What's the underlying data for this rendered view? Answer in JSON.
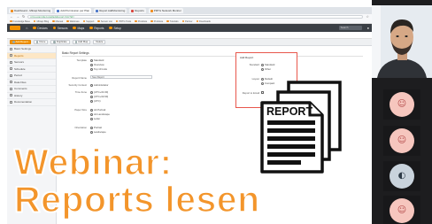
{
  "browser": {
    "tabs": [
      {
        "label": "Dashboard - Mitrapi Monitoring",
        "fav": "o",
        "active": false
      },
      {
        "label": "Add Permission per Plan",
        "fav": "b",
        "active": true
      },
      {
        "label": "Report AddMonitoring",
        "fav": "b",
        "active": false
      },
      {
        "label": "Reports",
        "fav": "r",
        "active": false
      },
      {
        "label": "PRTG Network Monitor",
        "fav": "o",
        "active": false
      }
    ],
    "url": "prtg.example.local/addreport.htm?id=",
    "bookmarks": [
      "Knowledge Base",
      "Mitrapi Blog",
      "Manual",
      "Webinare",
      "Support",
      "Sensor List",
      "PRTG Tools",
      "Preisliste",
      "Produkte",
      "Tutorials",
      "Partner",
      "Downloads"
    ]
  },
  "app": {
    "header_items": [
      "Devices",
      "Sensors",
      "Maps",
      "Reports",
      "Setup"
    ],
    "search_placeholder": "Search",
    "page_title": "ADD REPORT",
    "action_buttons": [
      "Add Report",
      "Clone",
      "Duplicate",
      "Add Map",
      "Delete"
    ]
  },
  "sidebar": {
    "items": [
      "Basic Settings",
      "Reports",
      "Sensors",
      "Schedule",
      "Period",
      "Data Files",
      "Comments",
      "History",
      "Documentation"
    ],
    "active_index": 1
  },
  "form": {
    "section_title": "Basic Report Settings",
    "template_label": "Template",
    "template_options": [
      "Standard",
      "Overview",
      "Top 10 Lists"
    ],
    "report_name_label": "Report Name",
    "report_name_value": "New Report",
    "security_label": "Security Context",
    "security_value": "Administrator",
    "timezone_label": "Time Zone",
    "timezone_options": [
      "(UTC+01:00)",
      "(UTC+02:00)",
      "(UTC)"
    ],
    "paper_label": "Paper Size",
    "paper_options": [
      "A4 Portrait",
      "A4 Landscape",
      "Letter"
    ],
    "orientation_label": "Orientation",
    "orientation_options": [
      "Portrait",
      "Landscape"
    ]
  },
  "add_report_box": {
    "title": "Add Report",
    "rows": [
      {
        "label": "Standard",
        "options": [
          "Standard",
          "Other"
        ]
      },
      {
        "label": "Layout",
        "options": [
          "Default",
          "Compact"
        ]
      },
      {
        "label": "Report to Email",
        "options": [
          ""
        ]
      }
    ]
  },
  "report_art": {
    "label": "REPORT"
  },
  "overlay": {
    "line1": "Webinar:",
    "line2": "Reports lesen"
  },
  "colors": {
    "accent": "#f3952b",
    "header": "#3a3f45",
    "highlight_box": "#e8574c"
  },
  "participants": [
    {
      "glyph": "☺",
      "color": "pink"
    },
    {
      "glyph": "☺",
      "color": "pink"
    },
    {
      "glyph": "◐",
      "color": "blue"
    },
    {
      "glyph": "☺",
      "color": "pink"
    }
  ]
}
